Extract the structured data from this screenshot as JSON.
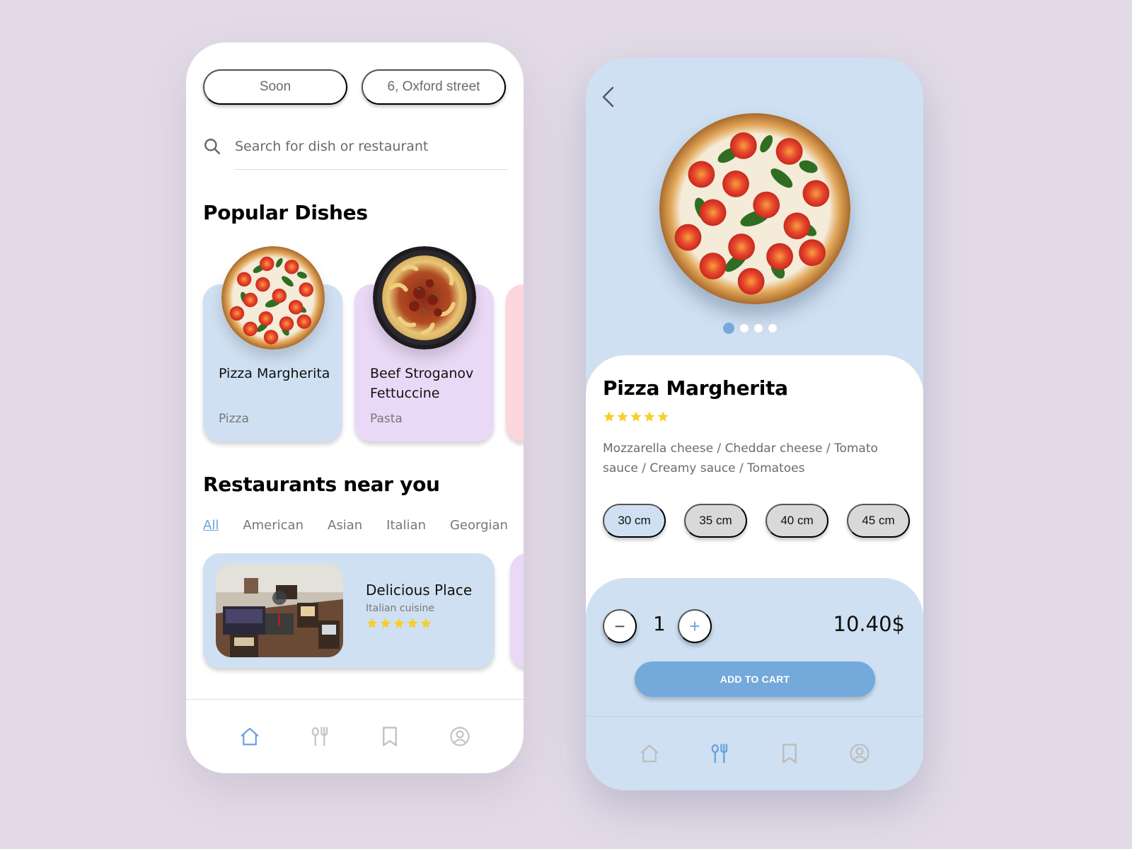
{
  "colors": {
    "background": "#e2dbe7",
    "accent_blue": "#74a9db",
    "card_blue": "#cfe0f2",
    "card_purple": "#ead9f6",
    "card_pink": "#fdd5dd",
    "star_yellow": "#f7ce2a",
    "icon_inactive": "#c4c4c4"
  },
  "home": {
    "pills": [
      {
        "label": "Soon"
      },
      {
        "label": "6, Oxford street"
      }
    ],
    "search": {
      "placeholder": "Search for dish or restaurant",
      "value": ""
    },
    "popular_title": "Popular Dishes",
    "dishes": [
      {
        "name": "Pizza Margherita",
        "category": "Pizza",
        "image": "pizza"
      },
      {
        "name": "Beef Stroganov Fettuccine",
        "category": "Pasta",
        "image": "pasta"
      }
    ],
    "restaurants_title": "Restaurants near you",
    "filters": [
      {
        "label": "All",
        "active": true
      },
      {
        "label": "American",
        "active": false
      },
      {
        "label": "Asian",
        "active": false
      },
      {
        "label": "Italian",
        "active": false
      },
      {
        "label": "Georgian",
        "active": false
      }
    ],
    "restaurants": [
      {
        "name": "Delicious Place",
        "cuisine": "Italian cuisine",
        "rating": 5,
        "image": "restaurant-interior"
      }
    ],
    "nav": [
      {
        "icon": "home-icon",
        "active": true
      },
      {
        "icon": "cutlery-icon",
        "active": false
      },
      {
        "icon": "bookmark-icon",
        "active": false
      },
      {
        "icon": "profile-icon",
        "active": false
      }
    ]
  },
  "detail": {
    "back_icon": "chevron-left-icon",
    "carousel": {
      "count": 4,
      "active_index": 0
    },
    "title": "Pizza Margherita",
    "rating": 5,
    "ingredients": "Mozzarella cheese / Cheddar cheese / Tomato sauce / Creamy sauce / Tomatoes",
    "sizes": [
      {
        "label": "30 cm",
        "selected": true
      },
      {
        "label": "35 cm",
        "selected": false
      },
      {
        "label": "40 cm",
        "selected": false
      },
      {
        "label": "45 cm",
        "selected": false
      }
    ],
    "quantity": {
      "minus_label": "−",
      "value": "1",
      "plus_label": "+"
    },
    "price": "10.40$",
    "add_to_cart_label": "ADD TO CART",
    "nav": [
      {
        "icon": "home-icon",
        "active": false
      },
      {
        "icon": "cutlery-icon",
        "active": true
      },
      {
        "icon": "bookmark-icon",
        "active": false
      },
      {
        "icon": "profile-icon",
        "active": false
      }
    ]
  }
}
